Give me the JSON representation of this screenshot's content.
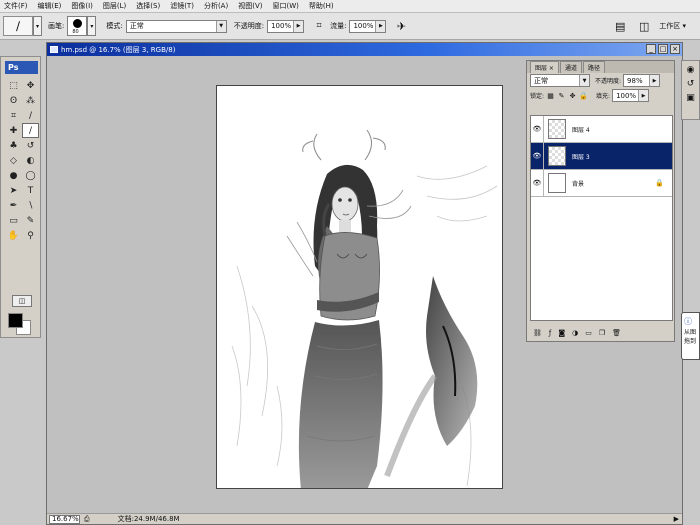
{
  "menubar": {
    "items": [
      "文件(F)",
      "编辑(E)",
      "图像(I)",
      "图层(L)",
      "选择(S)",
      "滤镜(T)",
      "分析(A)",
      "视图(V)",
      "窗口(W)",
      "帮助(H)"
    ]
  },
  "options": {
    "brush_label": "画笔:",
    "brush_size": "80",
    "mode_label": "模式:",
    "mode_value": "正常",
    "opacity_label": "不透明度:",
    "opacity_value": "100%",
    "flow_label": "流量:",
    "flow_value": "100%",
    "workspace_label": "工作区 ▾"
  },
  "toolbox": {
    "badge": "Ps",
    "tools": [
      {
        "name": "marquee-tool",
        "glyph": "⬚"
      },
      {
        "name": "move-tool",
        "glyph": "✥"
      },
      {
        "name": "lasso-tool",
        "glyph": "ʘ"
      },
      {
        "name": "magic-wand-tool",
        "glyph": "⁂"
      },
      {
        "name": "crop-tool",
        "glyph": "⌗"
      },
      {
        "name": "slice-tool",
        "glyph": "∕"
      },
      {
        "name": "healing-brush-tool",
        "glyph": "✚"
      },
      {
        "name": "brush-tool",
        "glyph": "∕"
      },
      {
        "name": "clone-stamp-tool",
        "glyph": "♣"
      },
      {
        "name": "history-brush-tool",
        "glyph": "↺"
      },
      {
        "name": "eraser-tool",
        "glyph": "◇"
      },
      {
        "name": "paint-bucket-tool",
        "glyph": "◐"
      },
      {
        "name": "blur-tool",
        "glyph": "●"
      },
      {
        "name": "dodge-tool",
        "glyph": "◯"
      },
      {
        "name": "path-selection-tool",
        "glyph": "➤"
      },
      {
        "name": "type-tool",
        "glyph": "T"
      },
      {
        "name": "pen-tool",
        "glyph": "✒"
      },
      {
        "name": "line-tool",
        "glyph": "∖"
      },
      {
        "name": "notes-tool",
        "glyph": "▭"
      },
      {
        "name": "eyedropper-tool",
        "glyph": "✎"
      },
      {
        "name": "hand-tool",
        "glyph": "✋"
      },
      {
        "name": "zoom-tool",
        "glyph": "⚲"
      }
    ]
  },
  "document": {
    "title": "hm.psd @ 16.7% (图层 3, RGB/8)",
    "zoom": "16.67%",
    "info": "文档:24.9M/46.8M"
  },
  "layers_panel": {
    "tabs": [
      "图层 ×",
      "通道",
      "路径"
    ],
    "blend_mode": "正常",
    "opacity_label": "不透明度:",
    "opacity_value": "98%",
    "lock_label": "锁定:",
    "fill_label": "填充:",
    "fill_value": "100%",
    "layers": [
      {
        "name": "图层 4",
        "selected": false
      },
      {
        "name": "图层 3",
        "selected": true
      },
      {
        "name": "背景",
        "selected": false
      }
    ]
  },
  "tooltip": {
    "text": "从图 拖到"
  }
}
